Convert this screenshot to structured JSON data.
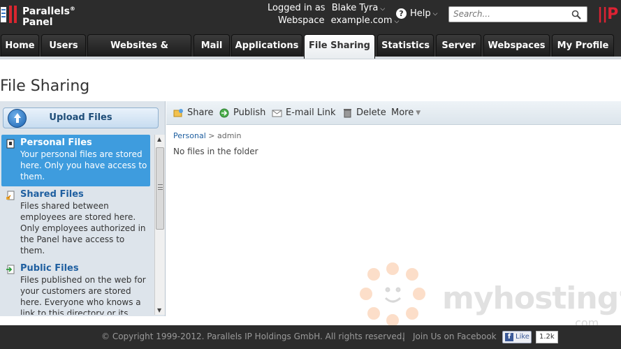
{
  "header": {
    "logo_line1": "Parallels",
    "logo_reg": "®",
    "logo_line2": "Panel",
    "logged_in_label": "Logged in as",
    "user_name": "Blake Tyra",
    "webspace_label": "Webspace",
    "webspace_value": "example.com",
    "help_label": "Help",
    "search_placeholder": "Search...",
    "brand_cut": "||P"
  },
  "tabs": [
    {
      "label": "Home"
    },
    {
      "label": "Users"
    },
    {
      "label": "Websites & Domains"
    },
    {
      "label": "Mail"
    },
    {
      "label": "Applications"
    },
    {
      "label": "File Sharing",
      "active": true
    },
    {
      "label": "Statistics"
    },
    {
      "label": "Server"
    },
    {
      "label": "Webspaces"
    },
    {
      "label": "My Profile"
    }
  ],
  "page": {
    "title": "File Sharing"
  },
  "left": {
    "upload_label": "Upload Files",
    "folders": [
      {
        "name": "Personal Files",
        "description": "Your personal files are stored here. Only you have access to them.",
        "icon": "personal-folder-icon"
      },
      {
        "name": "Shared Files",
        "description": "Files shared between employees are stored here. Only employees authorized in the Panel have access to them.",
        "icon": "shared-folder-icon"
      },
      {
        "name": "Public Files",
        "description": "Files published on the web for your customers are stored here. Everyone who knows a link to this directory or its",
        "icon": "public-folder-icon"
      }
    ]
  },
  "toolbar": {
    "share_label": "Share",
    "publish_label": "Publish",
    "email_label": "E-mail Link",
    "delete_label": "Delete",
    "more_label": "More"
  },
  "content": {
    "breadcrumb_root": "Personal",
    "breadcrumb_sep": ">",
    "breadcrumb_current": "admin",
    "empty_message": "No files in the folder"
  },
  "watermark": {
    "text": "myhosting",
    "reg": "®",
    "com": ".com"
  },
  "footer": {
    "copyright": "© Copyright 1999-2012. Parallels IP Holdings GmbH. All rights reserved.",
    "separator": "|",
    "fb_join": "Join Us on Facebook",
    "like_label": "Like",
    "like_count": "1.2k"
  },
  "colors": {
    "header_bg": "#2c2c2c",
    "active_folder_bg": "#3e9cde",
    "link_blue": "#1f5fa0"
  }
}
